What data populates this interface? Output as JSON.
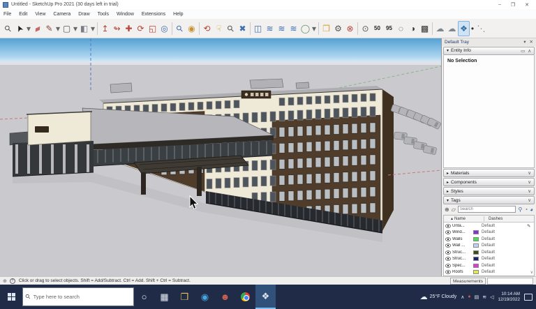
{
  "window": {
    "title": "Untitled - SketchUp Pro 2021 (30 days left in trial)",
    "controls": [
      {
        "n": "minimize-button",
        "g": "–"
      },
      {
        "n": "maximize-button",
        "g": "❐"
      },
      {
        "n": "close-button",
        "g": "✕"
      }
    ]
  },
  "menus": [
    "File",
    "Edit",
    "View",
    "Camera",
    "Draw",
    "Tools",
    "Window",
    "Extensions",
    "Help"
  ],
  "toolbar": {
    "icons": [
      {
        "n": "search-tool-icon",
        "g": "⚲",
        "c": "#555",
        "r": -45
      },
      {
        "n": "select-tool-icon",
        "g": "➤",
        "c": "#1a1a1a",
        "r": -115
      },
      {
        "n": "select-dropdown-icon",
        "g": "▾",
        "c": "#666",
        "w": "narrow"
      },
      {
        "n": "eraser-tool-icon",
        "g": "▰",
        "c": "#c46a6a",
        "r": -25
      },
      {
        "n": "line-tool-icon",
        "g": "✎",
        "c": "#8a4a3a"
      },
      {
        "n": "line-dropdown-icon",
        "g": "▾",
        "c": "#666",
        "w": "narrow"
      },
      {
        "n": "shapes-tool-icon",
        "g": "▢",
        "c": "#555"
      },
      {
        "n": "shapes-dropdown-icon",
        "g": "▾",
        "c": "#666",
        "w": "narrow"
      },
      {
        "n": "paint-bucket-tool-icon",
        "g": "◧",
        "c": "#7a7d85"
      },
      {
        "n": "paint-dropdown-icon",
        "g": "▾",
        "c": "#666",
        "w": "narrow"
      },
      {
        "sep": true
      },
      {
        "n": "push-pull-tool-icon",
        "g": "↥",
        "c": "#b5453a"
      },
      {
        "n": "follow-me-tool-icon",
        "g": "↬",
        "c": "#b5453a"
      },
      {
        "n": "move-tool-icon",
        "g": "✚",
        "c": "#b5453a"
      },
      {
        "n": "rotate-tool-icon",
        "g": "⟳",
        "c": "#b5453a"
      },
      {
        "n": "scale-tool-icon",
        "g": "◱",
        "c": "#b5453a"
      },
      {
        "n": "offset-tool-icon",
        "g": "◎",
        "c": "#3f6fae"
      },
      {
        "sep": true
      },
      {
        "n": "zoom-window-tool-icon",
        "g": "⚲",
        "c": "#3f6fae",
        "r": -45
      },
      {
        "n": "position-camera-tool-icon",
        "g": "◉",
        "c": "#c9912f"
      },
      {
        "sep": true
      },
      {
        "n": "orbit-tool-icon",
        "g": "⟲",
        "c": "#b5453a"
      },
      {
        "n": "pan-tool-icon",
        "g": "☟",
        "c": "#c9a227"
      },
      {
        "n": "zoom-tool-icon",
        "g": "⚲",
        "c": "#555",
        "r": -45
      },
      {
        "n": "zoom-extents-tool-icon",
        "g": "✖",
        "c": "#3f6fae"
      },
      {
        "sep": true
      },
      {
        "n": "section-plane-tool-icon",
        "g": "◫",
        "c": "#3f6fae"
      },
      {
        "n": "display-section-planes-icon",
        "g": "≋",
        "c": "#3f6fae"
      },
      {
        "n": "display-section-cuts-icon",
        "g": "≋",
        "c": "#3f6fae"
      },
      {
        "n": "display-section-fill-icon",
        "g": "≋",
        "c": "#3f6fae"
      },
      {
        "n": "styles-circle-icon",
        "g": "◯",
        "c": "#5f8f5f"
      },
      {
        "n": "styles-dropdown-icon",
        "g": "▾",
        "c": "#666",
        "w": "narrow"
      },
      {
        "sep": true
      },
      {
        "n": "open-model-icon",
        "g": "❒",
        "c": "#d9a33c"
      },
      {
        "n": "model-info-icon",
        "g": "⚙",
        "c": "#555"
      },
      {
        "n": "close-inspection-icon",
        "g": "⊗",
        "c": "#b5453a"
      },
      {
        "sep": true
      },
      {
        "n": "tag-visibility-icon",
        "g": "⊙",
        "c": "#555"
      },
      {
        "n": "style-50-icon",
        "g": "50",
        "c": "#222",
        "t": true
      },
      {
        "n": "style-95-icon",
        "g": "95",
        "c": "#222",
        "t": true
      },
      {
        "n": "face-style-wireframe-icon",
        "g": "◌",
        "c": "#333"
      },
      {
        "n": "face-style-shaded-icon",
        "g": "◑",
        "c": "#333"
      },
      {
        "n": "face-style-textured-icon",
        "g": "▩",
        "c": "#333"
      },
      {
        "sep": true
      },
      {
        "n": "get-models-warehouse-icon",
        "g": "☁",
        "c": "#7d8790"
      },
      {
        "n": "share-model-icon",
        "g": "☁",
        "c": "#7d8790"
      },
      {
        "n": "extension-warehouse-icon",
        "g": "❖",
        "c": "#2e6da4",
        "hl": true
      },
      {
        "n": "dot-icon",
        "g": "•",
        "c": "#333",
        "w": "narrow"
      },
      {
        "n": "axes-tool-icon",
        "g": "⋱",
        "c": "#888"
      }
    ]
  },
  "viewport": {
    "colors": {
      "sky_top": "#55a2d5",
      "sky_horizon": "#d6ebf8",
      "ground": "#cacace",
      "facade_cream": "#efe9d8",
      "facade_brown": "#503c2b",
      "glass_dark": "#26292d",
      "roof_grey": "#b7b7bb",
      "axis_blue": "#5577cc",
      "axis_green": "#86b886",
      "axis_red": "#cc7777"
    }
  },
  "tray": {
    "title": "Default Tray",
    "header_icons": [
      {
        "n": "pin-tray-icon",
        "g": "▾"
      },
      {
        "n": "close-tray-icon",
        "g": "✕"
      }
    ],
    "entity": {
      "arrow": "▾",
      "label": "Entity Info",
      "detach_icon": "▭",
      "chevron": "∧",
      "content": "No Selection"
    },
    "materials": {
      "arrow": "▸",
      "label": "Materials",
      "chevron": "∨"
    },
    "components": {
      "arrow": "▸",
      "label": "Components",
      "chevron": "∨"
    },
    "styles": {
      "arrow": "▸",
      "label": "Styles",
      "chevron": "∨"
    },
    "tags": {
      "arrow": "▾",
      "label": "Tags",
      "chevron": "∨",
      "toolbar_left": [
        {
          "n": "add-tag-icon",
          "g": "⊕"
        },
        {
          "n": "tag-label-icon",
          "g": "▱"
        }
      ],
      "search_placeholder": "Search",
      "toolbar_right": [
        {
          "n": "search-tags-icon",
          "g": "⚲"
        },
        {
          "n": "purge-tags-icon",
          "g": "◔"
        },
        {
          "n": "tag-details-icon",
          "g": "◕"
        }
      ],
      "sort_icon": "▴",
      "columns": [
        "Name",
        "Dashes"
      ],
      "rows": [
        {
          "name": "Unta...",
          "dashes": "Default",
          "color": null,
          "pencil": "✎"
        },
        {
          "name": "Wind...",
          "dashes": "Default",
          "color": "#8b30d9"
        },
        {
          "name": "Walls",
          "dashes": "Default",
          "color": "#46e24a"
        },
        {
          "name": "Wall ...",
          "dashes": "Default",
          "color": "#c3d1f4"
        },
        {
          "name": "Struc...",
          "dashes": "Default",
          "color": "#3f4d1c"
        },
        {
          "name": "Struc...",
          "dashes": "Default",
          "color": "#1b1f6e"
        },
        {
          "name": "Spec...",
          "dashes": "Default",
          "color": "#e03ad6"
        },
        {
          "name": "Roofs",
          "dashes": "Default",
          "color": "#e3e84b"
        }
      ],
      "scroll_icon": "∨"
    }
  },
  "status": {
    "hint": "Click or drag to select objects. Shift = Add/Subtract. Ctrl = Add. Shift + Ctrl = Subtract.",
    "measurements_label": "Measurements"
  },
  "taskbar": {
    "search_placeholder": "Type here to search",
    "apps": [
      {
        "n": "cortana-icon",
        "g": "○",
        "c": "#e8eef5"
      },
      {
        "n": "task-view-icon",
        "g": "▦",
        "c": "#e8eef5"
      },
      {
        "n": "file-explorer-icon",
        "g": "❒",
        "c": "#edc158"
      },
      {
        "n": "edge-browser-icon",
        "g": "◉",
        "c": "#46a6e0"
      },
      {
        "n": "people-icon",
        "g": "☻",
        "c": "#d0604f"
      },
      {
        "n": "chrome-icon",
        "chrome": true
      },
      {
        "n": "sketchup-taskbar-icon",
        "g": "❖",
        "c": "#dfe8f2",
        "active": true
      }
    ],
    "weather": {
      "temp": "25°F",
      "condition": "Cloudy"
    },
    "tray_icons": [
      {
        "n": "hidden-icons-caret",
        "g": "∧"
      },
      {
        "n": "onedrive-icon",
        "g": "●",
        "c": "#d05a4e"
      },
      {
        "n": "tray-app-icon",
        "g": "▤"
      },
      {
        "n": "network-icon",
        "g": "≋"
      },
      {
        "n": "volume-icon",
        "g": "◁"
      }
    ],
    "clock": {
      "time": "10:14 AM",
      "date": "12/19/2022"
    }
  }
}
